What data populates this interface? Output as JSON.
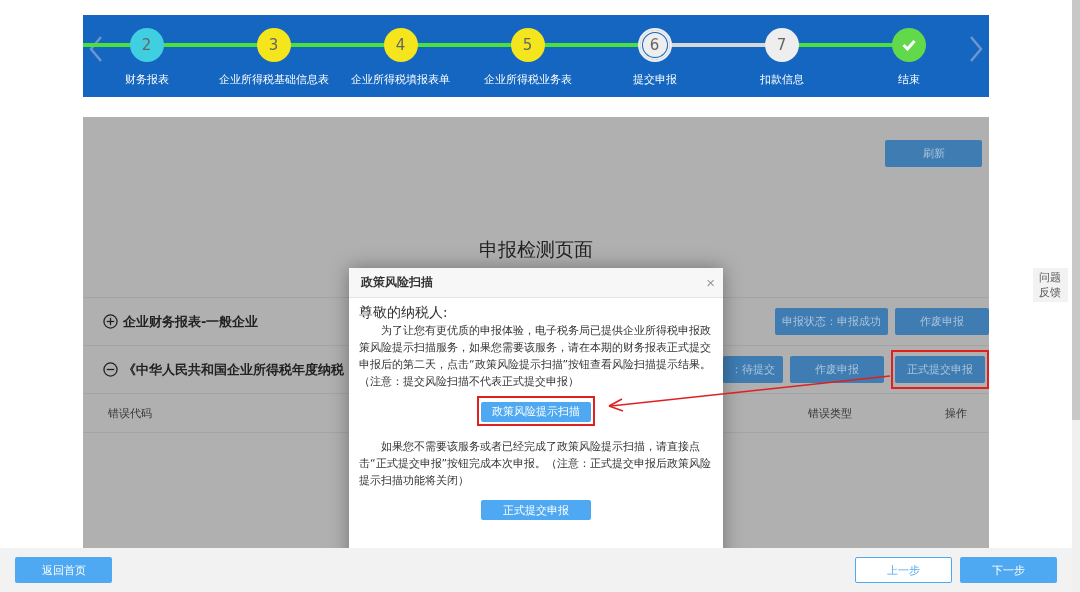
{
  "stepper": {
    "steps": [
      {
        "number": "2",
        "label": "财务报表",
        "color": "#3fcfe0",
        "completed": true,
        "current": false
      },
      {
        "number": "3",
        "label": "企业所得税基础信息表",
        "color": "#f4e51c",
        "completed": true,
        "current": false
      },
      {
        "number": "4",
        "label": "企业所得税填报表单",
        "color": "#f4e51c",
        "completed": true,
        "current": false
      },
      {
        "number": "5",
        "label": "企业所得税业务表",
        "color": "#f4e51c",
        "completed": true,
        "current": false
      },
      {
        "number": "6",
        "label": "提交申报",
        "color": "#eeeeee",
        "completed": false,
        "current": true
      },
      {
        "number": "7",
        "label": "扣款信息",
        "color": "#eeeeee",
        "completed": false,
        "current": false
      },
      {
        "label": "结束",
        "color": "#62d94b",
        "completed": true,
        "current": false,
        "kind": "check"
      }
    ]
  },
  "refresh_button": "刷新",
  "page_title": "申报检测页面",
  "sections": [
    {
      "title": "企业财务报表-一般企业",
      "expanded": false,
      "buttons": [
        {
          "label": "申报状态：申报成功",
          "highlighted": false
        },
        {
          "label": "作废申报",
          "highlighted": false
        }
      ]
    },
    {
      "title": "《中华人民共和国企业所得税年度纳税",
      "expanded": true,
      "buttons": [
        {
          "label": "：待提交",
          "highlighted": false
        },
        {
          "label": "作废申报",
          "highlighted": false
        },
        {
          "label": "正式提交申报",
          "highlighted": true
        }
      ]
    }
  ],
  "table": {
    "columns": [
      "错误代码",
      "错误类型",
      "操作"
    ]
  },
  "dialog": {
    "title": "政策风险扫描",
    "close_label": "×",
    "greeting": "尊敬的纳税人:",
    "paragraphs": [
      {
        "text": "为了让您有更优质的申报体验，电子税务局已提供企业所得税申报政策风险提示扫描服务，如果您需要该服务，请在本期的财务报表正式提交申报后的第二天，点击“政策风险提示扫描”按钮查看风险扫描提示结果。（注意：提交风险扫描不代表正式提交申报）",
        "button": {
          "label": "政策风险提示扫描",
          "highlighted": true
        }
      },
      {
        "text": "如果您不需要该服务或者已经完成了政策风险提示扫描，请直接点击“正式提交申报”按钮完成本次申报。（注意：正式提交申报后政策风险提示扫描功能将关闭）",
        "button": {
          "label": "正式提交申报",
          "highlighted": false
        }
      }
    ]
  },
  "feedback": "问题反馈",
  "footer": {
    "home_button": "返回首页",
    "prev_button": "上一步",
    "next_button": "下一步"
  }
}
